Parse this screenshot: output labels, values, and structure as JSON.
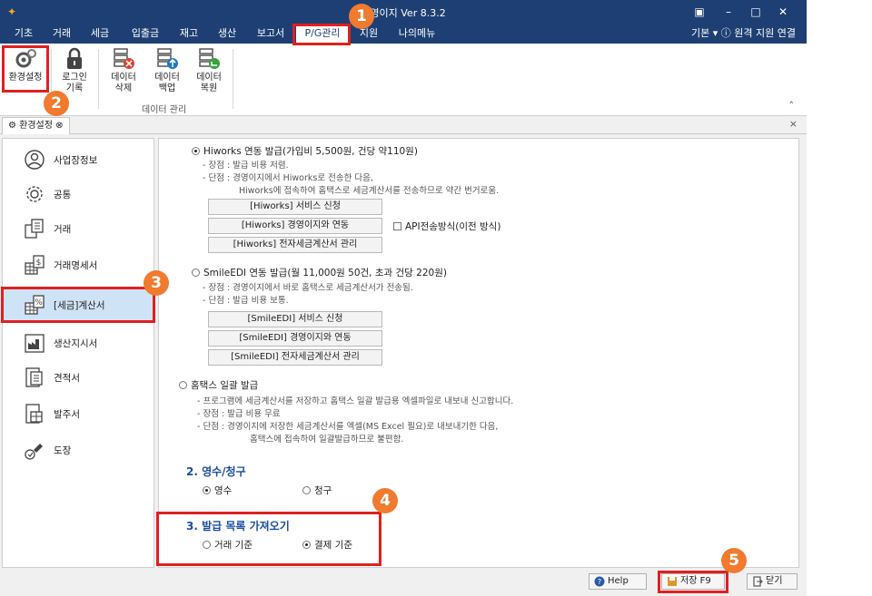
{
  "window": {
    "title": "경영이지 Ver 8.3.2"
  },
  "menu": {
    "items": [
      "기초",
      "거래",
      "세금",
      "입출금",
      "재고",
      "생산",
      "보고서",
      "P/G관리",
      "지원",
      "나의메뉴"
    ],
    "right_text": "기본 ▾  ⓘ 원격 지원 연결"
  },
  "ribbon": {
    "buttons": [
      {
        "label": "환경설정"
      },
      {
        "label1": "로그인",
        "label2": "기록"
      },
      {
        "label1": "데이터",
        "label2": "삭제"
      },
      {
        "label1": "데이터",
        "label2": "백업"
      },
      {
        "label1": "데이터",
        "label2": "복원"
      }
    ],
    "group_label": "데이터 관리"
  },
  "doc_tab": {
    "label": "환경설정",
    "close": "⊗"
  },
  "sidebar": {
    "items": [
      "사업장정보",
      "공통",
      "거래",
      "거래명세서",
      "[세금]계산서",
      "생산지시서",
      "견적서",
      "발주서",
      "도장"
    ]
  },
  "content": {
    "hiworks": {
      "label": "Hiworks 연동 발급(가입비 5,500원, 건당 약110원)",
      "pro": "- 장점 : 발급 비용 저렴.",
      "con1": "- 단점 : 경영이지에서 Hiworks로 전송한 다음,",
      "con2": "Hiworks에 접속하여 홈택스로 세금계산서를 전송하므로 약간 번거로움.",
      "btn1": "[Hiworks] 서비스 신청",
      "btn2": "[Hiworks] 경영이지와 연동",
      "btn3": "[Hiworks] 전자세금계산서 관리",
      "api_label": "API전송방식(이전 방식)"
    },
    "smileedi": {
      "label": "SmileEDI 연동 발급(월 11,000원 50건, 초과 건당 220원)",
      "pro": "- 장점 : 경영이지에서 바로 홈택스로 세금계산서가 전송됨.",
      "con": "- 단점 : 발급 비용 보통.",
      "btn1": "[SmileEDI] 서비스 신청",
      "btn2": "[SmileEDI] 경영이지와 연동",
      "btn3": "[SmileEDI] 전자세금계산서 관리"
    },
    "hometax": {
      "label": "홈택스 일괄 발급",
      "desc": "- 프로그램에 세금계산서를 저장하고 홈택스 일괄 발급용 엑셀파일로 내보내 신고합니다.",
      "pro": "- 장점 : 발급 비용 무료",
      "con1": "- 단점 : 경영이지에 저장한 세금계산서를 엑셀(MS Excel 필요)로 내보내기한 다음,",
      "con2": "홈택스에 접속하여 일괄발급하므로 불편함."
    },
    "section2": {
      "title": "2. 영수/청구",
      "opt1": "영수",
      "opt2": "청구"
    },
    "section3": {
      "title": "3. 발급 목록 가져오기",
      "opt1": "거래 기준",
      "opt2": "결제 기준"
    }
  },
  "bottom": {
    "help": "Help",
    "save": "저장 F9",
    "close": "닫기"
  },
  "badges": [
    "1",
    "2",
    "3",
    "4",
    "5"
  ],
  "colors": {
    "titlebar": "#1e3f73",
    "highlight": "#e02020",
    "badge": "#f07a2e",
    "section_title": "#1a4d9e"
  }
}
